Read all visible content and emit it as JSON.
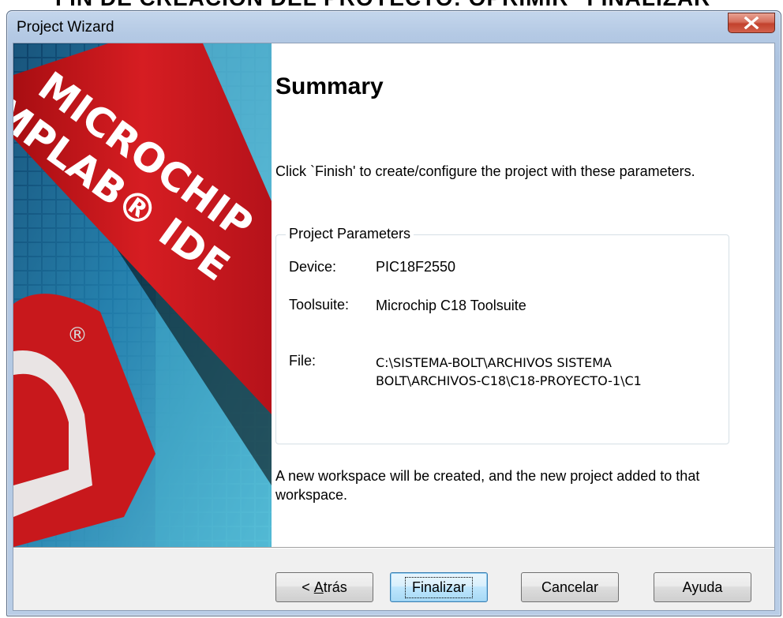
{
  "caption": "FIN DE CREACION DEL PROYECTO: OPRIMIR \"FINALIZAR\"",
  "window": {
    "title": "Project Wizard",
    "close_glyph": "✕"
  },
  "banner": {
    "logo_line1": "MICROCHIP",
    "logo_line2": "MPLAB® IDE",
    "registered_mark": "®",
    "colors": {
      "red": "#c8181c",
      "blue": "#1f6f9a",
      "cyan": "#5fc4dc"
    }
  },
  "summary": {
    "title": "Summary",
    "instructions": "Click `Finish' to create/configure the project with these parameters."
  },
  "parameters": {
    "legend": "Project Parameters",
    "device_label": "Device:",
    "device_value": "PIC18F2550",
    "toolsuite_label": "Toolsuite:",
    "toolsuite_value": "Microchip C18 Toolsuite",
    "file_label": "File:",
    "file_value_line1": "C:\\SISTEMA-BOLT\\ARCHIVOS SISTEMA",
    "file_value_line2": "BOLT\\ARCHIVOS-C18\\C18-PROYECTO-1\\C1"
  },
  "footer_note": "A new workspace will be created, and the new project added to that workspace.",
  "buttons": {
    "back_prefix": "< ",
    "back_mnemonic": "A",
    "back_rest": "trás",
    "finish": "Finalizar",
    "cancel": "Cancelar",
    "help": "Ayuda"
  }
}
